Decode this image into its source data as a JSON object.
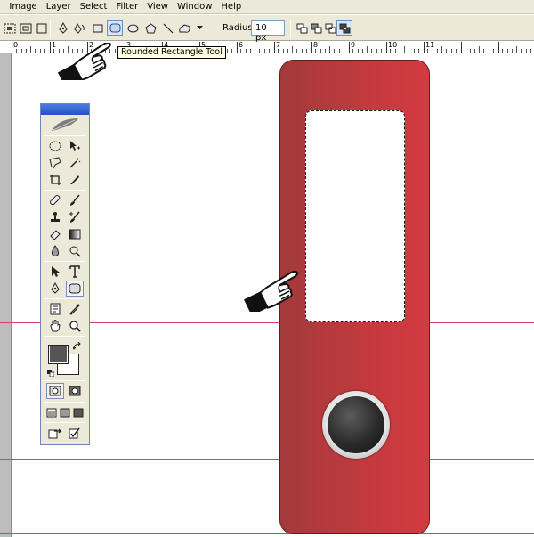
{
  "menubar": {
    "items": [
      ":",
      "Image",
      "Layer",
      "Select",
      "Filter",
      "View",
      "Window",
      "Help"
    ]
  },
  "options_bar": {
    "radius_label": "Radius:",
    "radius_value": "10 px"
  },
  "tooltip": {
    "text": "Rounded Rectangle Tool"
  },
  "ruler": {
    "labels": [
      "0",
      "1",
      "2",
      "3",
      "4",
      "5",
      "6",
      "7",
      "8",
      "9",
      "10",
      "11"
    ]
  },
  "colors": {
    "guide": "#d83d7a",
    "binder": "#c83a3f",
    "toolbox_title": "#2454c4"
  }
}
